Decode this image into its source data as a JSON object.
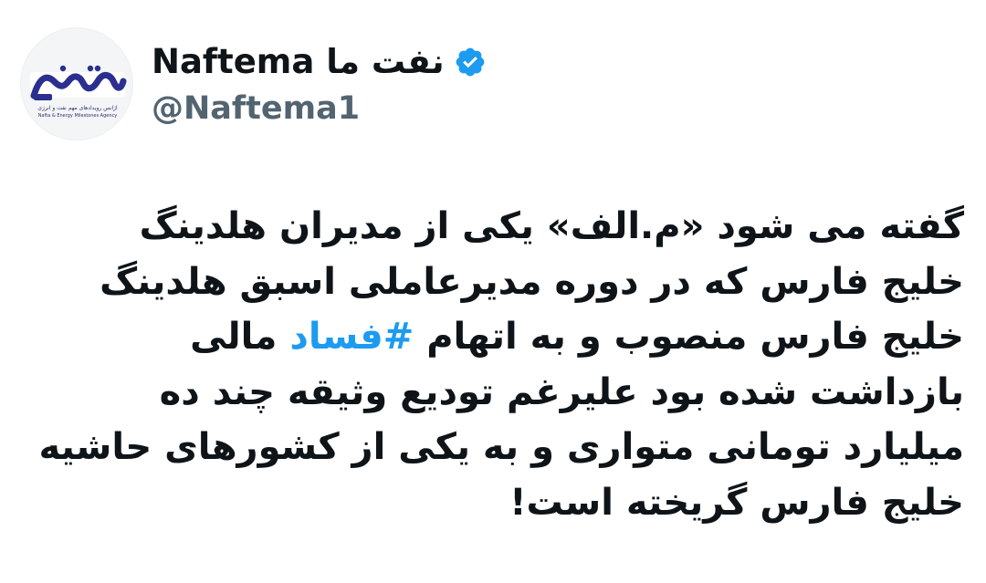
{
  "author": {
    "display_name": "Naftema نفت ما",
    "handle": "@Naftema1",
    "verified": true,
    "avatar": {
      "logo_text": "نفت‌ما",
      "subtitle_fa": "آژانس رویدادهای مهم نفت و انرژی",
      "subtitle_en": "Nafta & Energy Milestones Agency"
    }
  },
  "tweet": {
    "lines": [
      {
        "text": "گفته می شود «م.الف» یکی از مدیران هلدینگ"
      },
      {
        "text": "خلیج فارس که در دوره مدیرعاملی اسبق هلدینگ"
      },
      {
        "before": "خلیج فارس منصوب و به اتهام ",
        "hashtag": "#فساد",
        "after": " مالی"
      },
      {
        "text": "بازداشت شده بود علیرغم تودیع وثیقه چند ده"
      },
      {
        "text": "میلیارد تومانی متواری و به یکی از کشورهای حاشیه"
      },
      {
        "text": "خلیج فارس گریخته است!"
      }
    ]
  },
  "colors": {
    "text": "#0f1419",
    "handle": "#536471",
    "hashtag": "#1d9bf0",
    "verified": "#1d9bf0",
    "logo": "#2b2f8f"
  }
}
